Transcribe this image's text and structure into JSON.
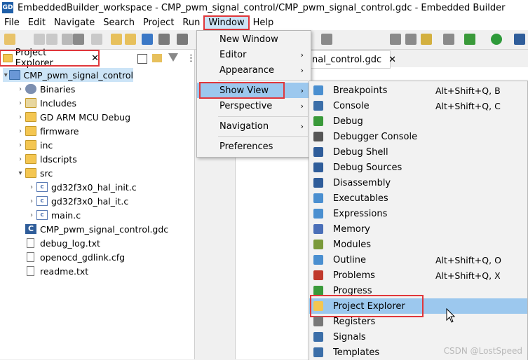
{
  "window": {
    "app_icon_text": "GD",
    "title": "EmbeddedBuilder_workspace - CMP_pwm_signal_control/CMP_pwm_signal_control.gdc - Embedded Builder"
  },
  "menubar": [
    "File",
    "Edit",
    "Navigate",
    "Search",
    "Project",
    "Run",
    "Window",
    "Help"
  ],
  "project_explorer": {
    "tab_label": "Project Explorer",
    "close_glyph": "✕",
    "tree": [
      {
        "label": "CMP_pwm_signal_control",
        "arrow": "▾",
        "icon": "project-icon"
      },
      {
        "label": "Binaries",
        "arrow": "›",
        "icon": "binaries-icon"
      },
      {
        "label": "Includes",
        "arrow": "›",
        "icon": "includes-icon"
      },
      {
        "label": "GD ARM MCU Debug",
        "arrow": "›",
        "icon": "folder-icon"
      },
      {
        "label": "firmware",
        "arrow": "›",
        "icon": "folder-icon"
      },
      {
        "label": "inc",
        "arrow": "›",
        "icon": "folder-icon"
      },
      {
        "label": "ldscripts",
        "arrow": "›",
        "icon": "folder-icon"
      },
      {
        "label": "src",
        "arrow": "▾",
        "icon": "folder-icon"
      },
      {
        "label": "gd32f3x0_hal_init.c",
        "arrow": "›",
        "icon": "c-file-icon"
      },
      {
        "label": "gd32f3x0_hal_it.c",
        "arrow": "›",
        "icon": "c-file-icon"
      },
      {
        "label": "main.c",
        "arrow": "›",
        "icon": "c-file-icon"
      },
      {
        "label": "CMP_pwm_signal_control.gdc",
        "arrow": "",
        "icon": "gdc-file-icon"
      },
      {
        "label": "debug_log.txt",
        "arrow": "",
        "icon": "text-file-icon"
      },
      {
        "label": "openocd_gdlink.cfg",
        "arrow": "",
        "icon": "text-file-icon"
      },
      {
        "label": "readme.txt",
        "arrow": "",
        "icon": "text-file-icon"
      }
    ]
  },
  "editor": {
    "tab_label": "nal_control.gdc",
    "close_glyph": "✕"
  },
  "window_menu": {
    "items": [
      "New Window",
      "Editor",
      "Appearance",
      "Show View",
      "Perspective",
      "Navigation",
      "Preferences"
    ],
    "submenu_arrow": "›"
  },
  "show_view_menu": {
    "items": [
      {
        "label": "Breakpoints",
        "shortcut": "Alt+Shift+Q, B",
        "icon": "breakpoints-icon",
        "color": "#4a8fd0"
      },
      {
        "label": "Console",
        "shortcut": "Alt+Shift+Q, C",
        "icon": "console-icon",
        "color": "#3b6ea8"
      },
      {
        "label": "Debug",
        "shortcut": "",
        "icon": "debug-bug-icon",
        "color": "#3a9a3a"
      },
      {
        "label": "Debugger Console",
        "shortcut": "",
        "icon": "debugger-console-icon",
        "color": "#555555"
      },
      {
        "label": "Debug Shell",
        "shortcut": "",
        "icon": "debug-shell-icon",
        "color": "#2f5d9a"
      },
      {
        "label": "Debug Sources",
        "shortcut": "",
        "icon": "debug-sources-icon",
        "color": "#2f5d9a"
      },
      {
        "label": "Disassembly",
        "shortcut": "",
        "icon": "disassembly-icon",
        "color": "#2f5d9a"
      },
      {
        "label": "Executables",
        "shortcut": "",
        "icon": "executables-icon",
        "color": "#4a8fd0"
      },
      {
        "label": "Expressions",
        "shortcut": "",
        "icon": "expressions-icon",
        "color": "#4a8fd0"
      },
      {
        "label": "Memory",
        "shortcut": "",
        "icon": "memory-icon",
        "color": "#4a6fb8"
      },
      {
        "label": "Modules",
        "shortcut": "",
        "icon": "modules-icon",
        "color": "#7a9a3a"
      },
      {
        "label": "Outline",
        "shortcut": "Alt+Shift+Q, O",
        "icon": "outline-icon",
        "color": "#4a8fd0"
      },
      {
        "label": "Problems",
        "shortcut": "Alt+Shift+Q, X",
        "icon": "problems-icon",
        "color": "#c0392b"
      },
      {
        "label": "Progress",
        "shortcut": "",
        "icon": "progress-icon",
        "color": "#3a9a3a"
      },
      {
        "label": "Project Explorer",
        "shortcut": "",
        "icon": "project-explorer-icon",
        "color": "#f4c651"
      },
      {
        "label": "Registers",
        "shortcut": "",
        "icon": "registers-icon",
        "color": "#777777"
      },
      {
        "label": "Signals",
        "shortcut": "",
        "icon": "signals-icon",
        "color": "#3b6ea8"
      },
      {
        "label": "Templates",
        "shortcut": "",
        "icon": "templates-icon",
        "color": "#3b6ea8"
      }
    ]
  },
  "watermark": "CSDN @LostSpeed",
  "colors": {
    "highlight": "#cce4f7",
    "menu_highlight": "#9cc8ee",
    "annotation_red": "#e0373b"
  }
}
